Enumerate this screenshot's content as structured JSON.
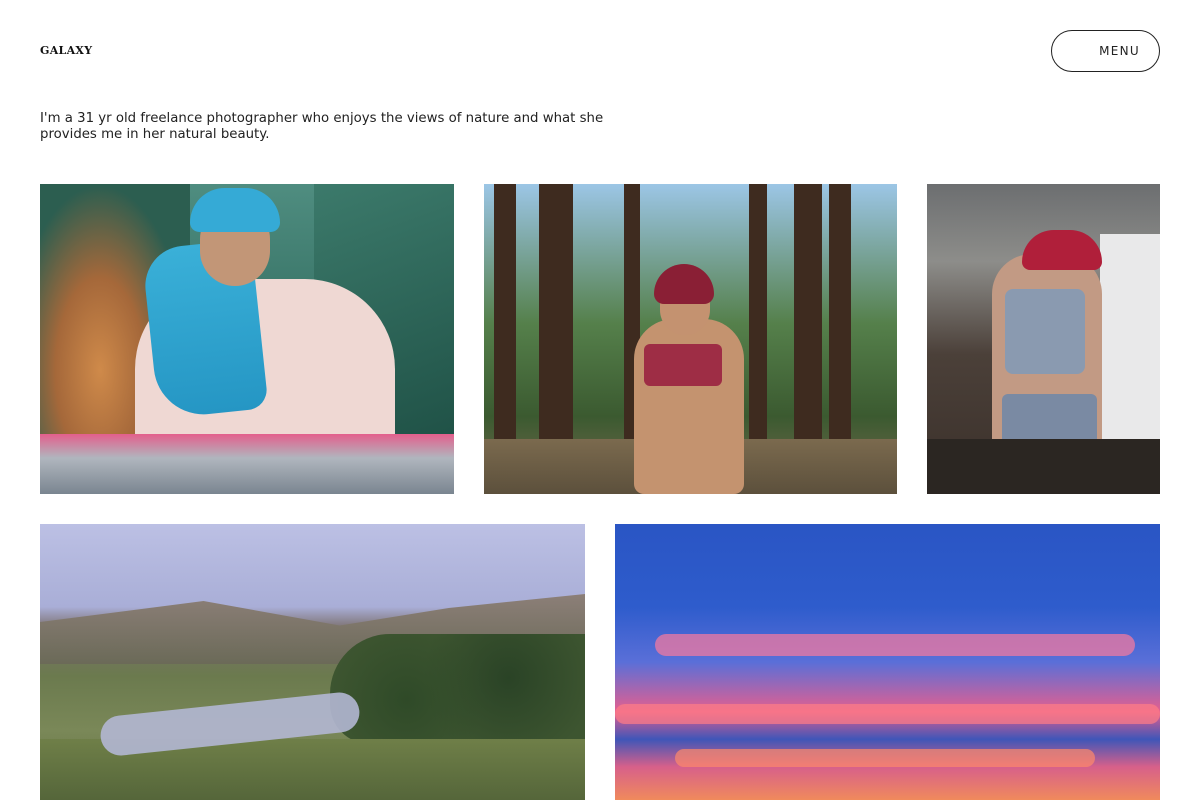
{
  "header": {
    "logo": "GALAXY",
    "menu_label": "MENU"
  },
  "intro": {
    "text": "I'm a 31 yr old freelance photographer who enjoys the views of nature and what she provides me in her natural beauty."
  },
  "gallery": {
    "photos": [
      {
        "subject": "woman in blue headscarf inside green tent"
      },
      {
        "subject": "woman in red headwrap among pine forest"
      },
      {
        "subject": "woman in red headwrap in kitchen"
      },
      {
        "subject": "landscape with river, hills and trees"
      },
      {
        "subject": "blue sky with pink sunset clouds"
      }
    ]
  }
}
